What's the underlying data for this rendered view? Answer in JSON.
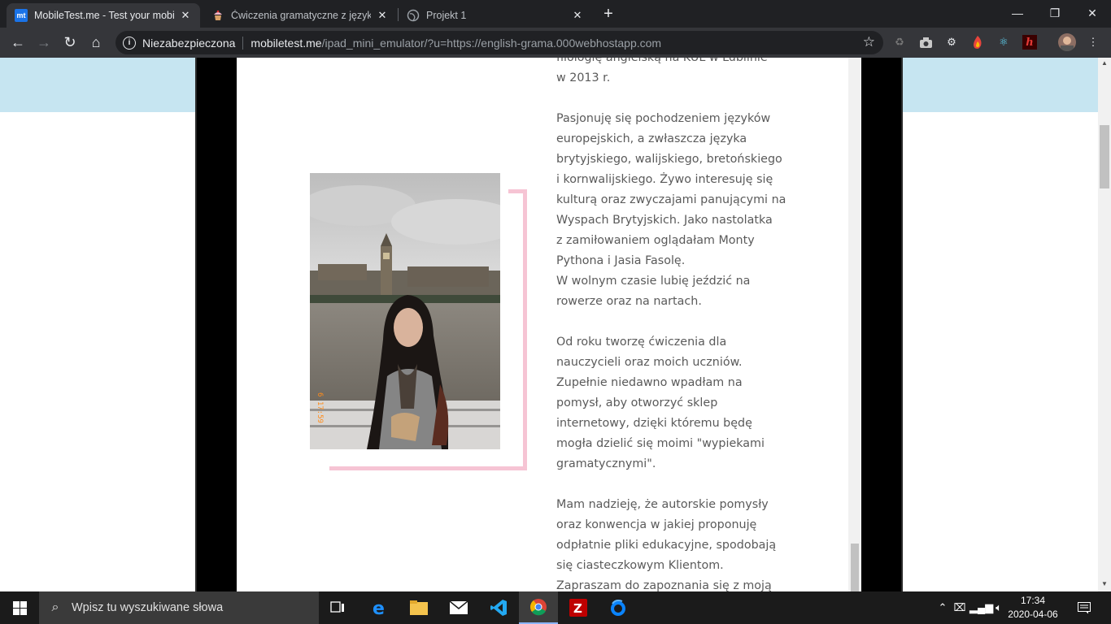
{
  "tabs": [
    {
      "title": "MobileTest.me - Test your mobile",
      "favicon": "mt"
    },
    {
      "title": "Ćwiczenia gramatyczne z języka a",
      "favicon": "cupcake-icon"
    },
    {
      "title": "Projekt 1",
      "favicon": "globe-icon"
    }
  ],
  "omnibox": {
    "security_label": "Niezabezpieczona",
    "host": "mobiletest.me",
    "path": "/ipad_mini_emulator/?u=https://english-grama.000webhostapp.com"
  },
  "bio": {
    "p1_lines": [
      "filologię angielską na KUL w Lublinie",
      "w 2013 r."
    ],
    "p2_lines": [
      "Pasjonuję się pochodzeniem języków",
      "europejskich, a zwłaszcza języka",
      "brytyjskiego, walijskiego, bretońskiego",
      "i kornwalijskiego. Żywo interesuję się",
      "kulturą oraz zwyczajami panującymi na",
      "Wyspach Brytyjskich. Jako nastolatka",
      "z zamiłowaniem oglądałam Monty",
      "Pythona i Jasia Fasolę.",
      "W wolnym czasie lubię jeździć na",
      "rowerze oraz na nartach."
    ],
    "p3_lines": [
      "Od roku tworzę ćwiczenia dla",
      "nauczycieli oraz moich uczniów.",
      "Zupełnie niedawno wpadłam na",
      "pomysł, aby otworzyć sklep",
      "internetowy, dzięki któremu będę",
      "mogła dzielić się moimi \"wypiekami",
      "gramatycznymi\"."
    ],
    "p4_lines": [
      "Mam nadzieję, że autorskie pomysły",
      "oraz konwencja w jakiej proponuję",
      "odpłatnie pliki edukacyjne, spodobają",
      "się ciasteczkowym Klientom.",
      "Zapraszam do zapoznania się z moją"
    ]
  },
  "photo": {
    "caption_stamp": "6 17:59"
  },
  "taskbar": {
    "search_placeholder": "Wpisz tu wyszukiwane słowa",
    "time": "17:34",
    "date": "2020-04-06"
  },
  "colors": {
    "accent_pink": "#f6c4d4",
    "header_band": "#c6e5f1",
    "chrome_dark": "#202124"
  }
}
